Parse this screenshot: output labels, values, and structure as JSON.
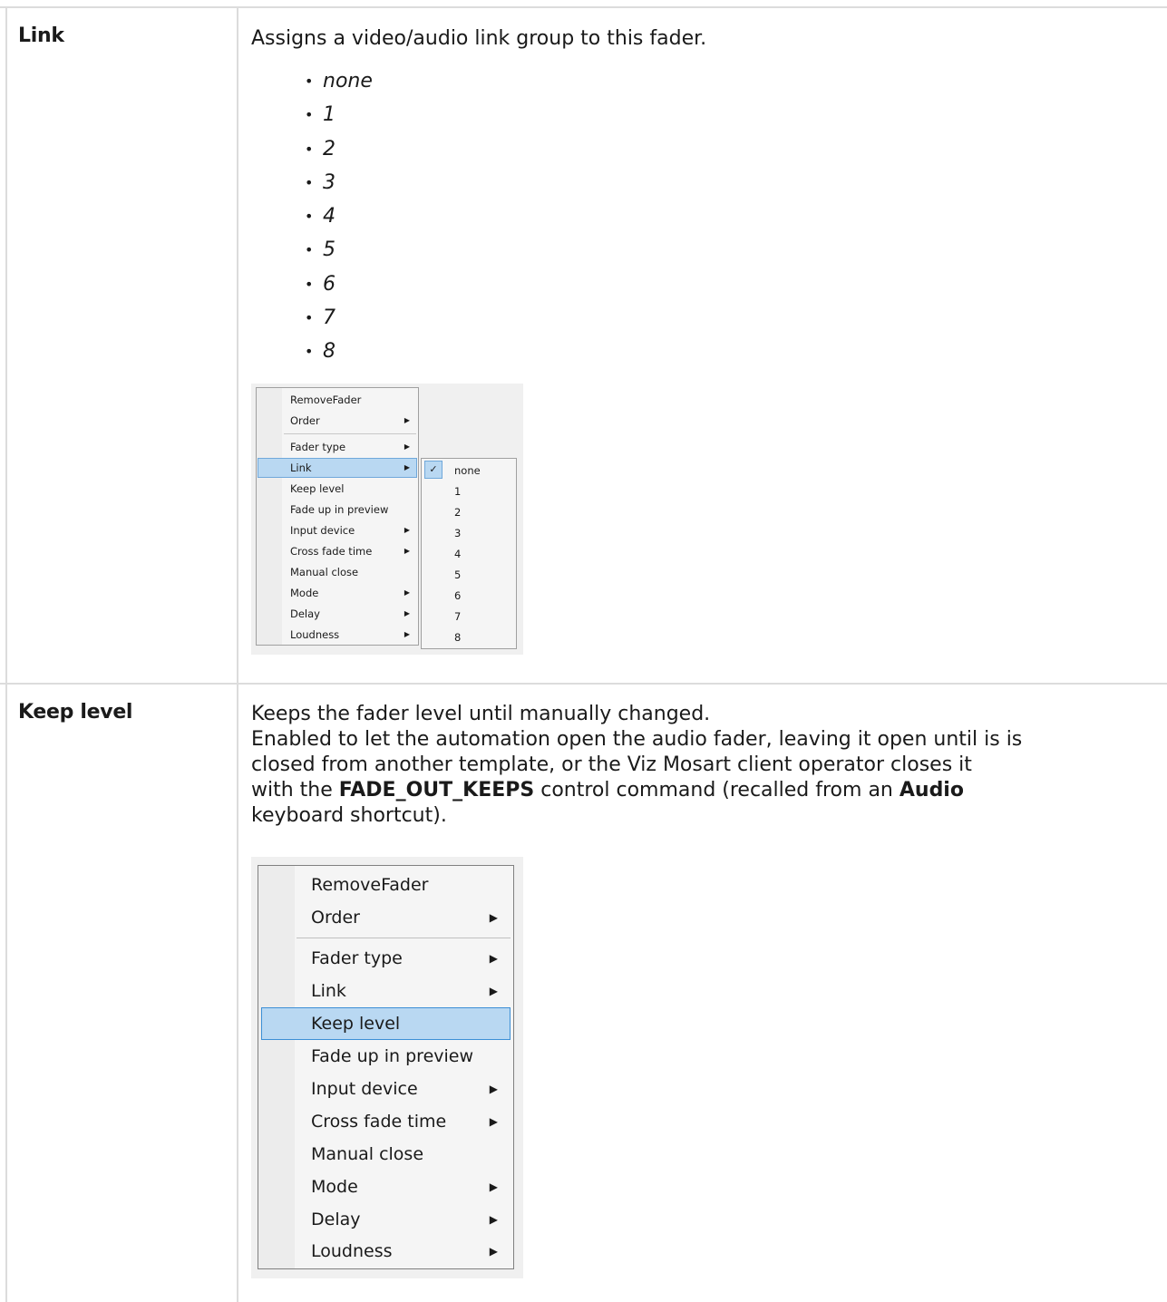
{
  "rows": [
    {
      "label": "Link",
      "description": "Assigns a video/audio link group to this fader.",
      "options": [
        "none",
        "1",
        "2",
        "3",
        "4",
        "5",
        "6",
        "7",
        "8"
      ]
    },
    {
      "label": "Keep level",
      "description_lines": [
        "Keeps the fader level until manually changed.",
        "Enabled to let the automation open the audio fader, leaving it open until is is",
        "closed from another template, or the Viz Mosart client operator closes it"
      ],
      "line4_pre": "with the ",
      "line4_bold1": "FADE_OUT_KEEPS",
      "line4_mid": " control command (recalled from an ",
      "line4_bold2": "Audio",
      "line5": "keyboard shortcut)."
    }
  ],
  "menu": {
    "items": [
      "RemoveFader",
      "Order",
      "Fader type",
      "Link",
      "Keep level",
      "Fade up in preview",
      "Input device",
      "Cross fade time",
      "Manual close",
      "Mode",
      "Delay",
      "Loudness"
    ],
    "arrow_glyph": "▶"
  },
  "link_submenu": {
    "check_glyph": "✓",
    "items": [
      "none",
      "1",
      "2",
      "3",
      "4",
      "5",
      "6",
      "7",
      "8"
    ]
  }
}
